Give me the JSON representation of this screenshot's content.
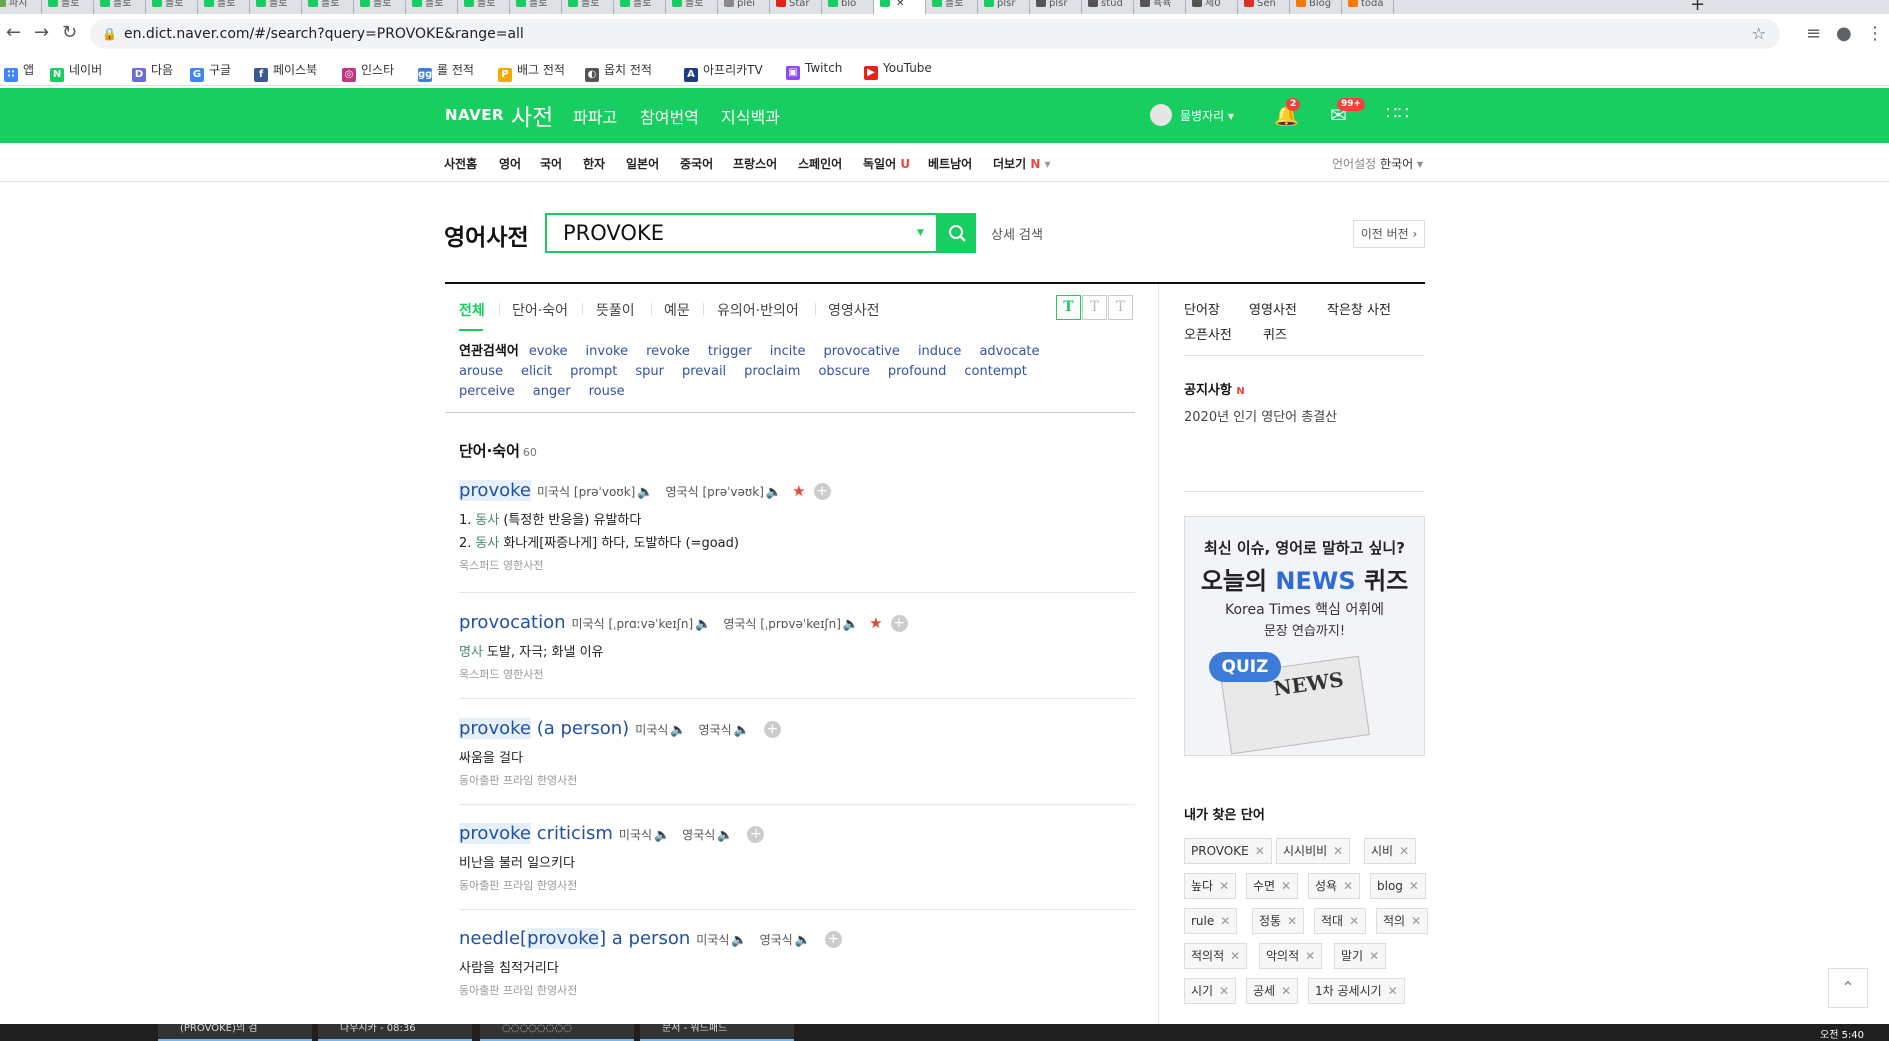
{
  "browser": {
    "tabs": [
      {
        "label": "파지",
        "color": "#6aa84f"
      },
      {
        "label": "블로",
        "color": "#19ce60"
      },
      {
        "label": "블로",
        "color": "#19ce60"
      },
      {
        "label": "블로",
        "color": "#19ce60"
      },
      {
        "label": "블로",
        "color": "#19ce60"
      },
      {
        "label": "블로",
        "color": "#19ce60"
      },
      {
        "label": "블로",
        "color": "#19ce60"
      },
      {
        "label": "블로",
        "color": "#19ce60"
      },
      {
        "label": "블로",
        "color": "#19ce60"
      },
      {
        "label": "블로",
        "color": "#19ce60"
      },
      {
        "label": "블로",
        "color": "#19ce60"
      },
      {
        "label": "블로",
        "color": "#19ce60"
      },
      {
        "label": "블로",
        "color": "#19ce60"
      },
      {
        "label": "블로",
        "color": "#19ce60"
      },
      {
        "label": "plei",
        "color": "#888888"
      },
      {
        "label": "Star",
        "color": "#e62117"
      },
      {
        "label": "blo",
        "color": "#19ce60"
      },
      {
        "label": "",
        "color": "#19ce60",
        "active": true
      },
      {
        "label": "블로",
        "color": "#19ce60"
      },
      {
        "label": "plsr",
        "color": "#19ce60"
      },
      {
        "label": "plsr",
        "color": "#555555"
      },
      {
        "label": "stud",
        "color": "#555555"
      },
      {
        "label": "육육",
        "color": "#555555"
      },
      {
        "label": "제0",
        "color": "#555555"
      },
      {
        "label": "Sen",
        "color": "#d93025"
      },
      {
        "label": "Blog",
        "color": "#f57c00"
      },
      {
        "label": "toda",
        "color": "#f57c00"
      }
    ],
    "url": "en.dict.naver.com/#/search?query=PROVOKE&range=all",
    "bookmarks": [
      {
        "label": "앱",
        "icon": "apps-grid-icon",
        "color": "#4285f4"
      },
      {
        "label": "네이버",
        "icon": "naver-icon",
        "color": "#19ce60"
      },
      {
        "label": "다음",
        "icon": "daum-icon",
        "color": "#6d6dd9"
      },
      {
        "label": "구글",
        "icon": "google-icon",
        "color": "#4285f4"
      },
      {
        "label": "페이스북",
        "icon": "facebook-icon",
        "color": "#3b5998"
      },
      {
        "label": "인스타",
        "icon": "instagram-icon",
        "color": "#c13584"
      },
      {
        "label": "롤 전적",
        "icon": "op-gg-icon",
        "color": "#3f7fe0"
      },
      {
        "label": "배그 전적",
        "icon": "pubg-icon",
        "color": "#f2a900"
      },
      {
        "label": "옵치 전적",
        "icon": "overwatch-icon",
        "color": "#555555"
      },
      {
        "label": "아프리카TV",
        "icon": "afreecatv-icon",
        "color": "#1e3a8a"
      },
      {
        "label": "Twitch",
        "icon": "twitch-icon",
        "color": "#9146ff"
      },
      {
        "label": "YouTube",
        "icon": "youtube-icon",
        "color": "#e62117"
      }
    ]
  },
  "header": {
    "logo": "NAVER",
    "dict_name": "사전",
    "nav": [
      "파파고",
      "참여번역",
      "지식백과"
    ],
    "user": "물병자리",
    "notif_count": "2",
    "mail_count": "99+"
  },
  "subnav": {
    "items": [
      "사전홈",
      "영어",
      "국어",
      "한자",
      "일본어",
      "중국어",
      "프랑스어",
      "스페인어",
      "독일어",
      "베트남어",
      "더보기"
    ],
    "de_new": "U",
    "more_new": "N",
    "lang_label": "언어설정",
    "lang_value": "한국어"
  },
  "search": {
    "page_title": "영어사전",
    "query": "PROVOKE",
    "detail": "상세 검색",
    "old_version": "이전 버전"
  },
  "content_tabs": [
    "전체",
    "단어·숙어",
    "뜻풀이",
    "예문",
    "유의어·반의어",
    "영영사전"
  ],
  "font_buttons": [
    "T",
    "T",
    "T"
  ],
  "related": {
    "label": "연관검색어",
    "words": [
      "evoke",
      "invoke",
      "revoke",
      "trigger",
      "incite",
      "provocative",
      "induce",
      "advocate",
      "arouse",
      "elicit",
      "prompt",
      "spur",
      "prevail",
      "proclaim",
      "obscure",
      "profound",
      "contempt",
      "perceive",
      "anger",
      "rouse"
    ]
  },
  "section": {
    "title": "단어·숙어",
    "count": "60"
  },
  "entries": [
    {
      "pre": "",
      "hl": "provoke",
      "post": "",
      "us_label": "미국식",
      "us_pron": "[prəˈvoʊk]",
      "uk_label": "영국식",
      "uk_pron": "[prəˈvəʊk]",
      "star": true,
      "meanings": [
        {
          "num": "1.",
          "pos": "동사",
          "text": "(특정한 반응을) 유발하다"
        },
        {
          "num": "2.",
          "pos": "동사",
          "text": "화나게[짜증나게] 하다, 도발하다 (=goad)"
        }
      ],
      "source": "옥스퍼드 영한사전"
    },
    {
      "pre": "",
      "hl": "",
      "post": "provocation",
      "us_label": "미국식",
      "us_pron": "[ˌprɑːvəˈkeɪʃn]",
      "uk_label": "영국식",
      "uk_pron": "[ˌprɒvəˈkeɪʃn]",
      "star": true,
      "meanings": [
        {
          "num": "",
          "pos": "명사",
          "text": "도발, 자극; 화낼 이유"
        }
      ],
      "source": "옥스퍼드 영한사전"
    },
    {
      "pre": "",
      "hl": "provoke",
      "post": " (a person)",
      "us_label": "미국식",
      "us_pron": "",
      "uk_label": "영국식",
      "uk_pron": "",
      "star": false,
      "meanings": [
        {
          "num": "",
          "pos": "",
          "text": "싸움을 걸다"
        }
      ],
      "source": "동아출판 프라임 한영사전"
    },
    {
      "pre": "",
      "hl": "provoke",
      "post": " criticism",
      "us_label": "미국식",
      "us_pron": "",
      "uk_label": "영국식",
      "uk_pron": "",
      "star": false,
      "meanings": [
        {
          "num": "",
          "pos": "",
          "text": "비난을 불러 일으키다"
        }
      ],
      "source": "동아출판 프라임 한영사전"
    },
    {
      "pre": "needle[",
      "hl": "provoke",
      "post": "] a person",
      "us_label": "미국식",
      "us_pron": "",
      "uk_label": "영국식",
      "uk_pron": "",
      "star": false,
      "meanings": [
        {
          "num": "",
          "pos": "",
          "text": "사람을 침적거리다"
        }
      ],
      "source": "동아출판 프라임 한영사전"
    }
  ],
  "sidebar": {
    "links": [
      "단어장",
      "영영사전",
      "작은창 사전",
      "오픈사전",
      "퀴즈"
    ],
    "notice_title": "공지사항",
    "notice_new": "N",
    "notice_text": "2020년 인기 영단어 총결산",
    "ad": {
      "line1": "최신 이슈, 영어로 말하고 싶니?",
      "line2_a": "오늘의 ",
      "line2_b": "NEWS",
      "line2_c": " 퀴즈",
      "line3": "Korea Times 핵심 어휘에",
      "line4": "문장 연습까지!",
      "quiz": "QUIZ",
      "paper": "NEWS"
    },
    "mywords_title": "내가 찾은 단어",
    "mywords": [
      "PROVOKE",
      "시시비비",
      "시비",
      "높다",
      "수면",
      "성욕",
      "blog",
      "rule",
      "정통",
      "적대",
      "적의",
      "적의적",
      "악의적",
      "말기",
      "시기",
      "공세",
      "1차 공세시기"
    ]
  },
  "taskbar": {
    "items": [
      "(PROVOKE)의 검",
      "나우시카 - 08:36",
      "◌◌◌◌◌◌◌◌",
      "문서 - 워드패드"
    ],
    "clock": "오전 5:40"
  }
}
